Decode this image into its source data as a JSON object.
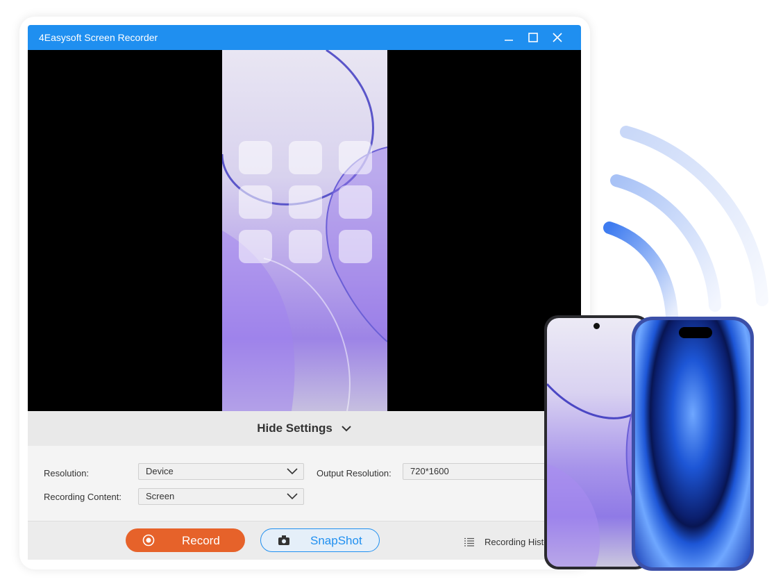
{
  "window": {
    "title": "4Easysoft Screen Recorder",
    "controls": {
      "minimize": "minimize-icon",
      "maximize": "maximize-icon",
      "close": "close-icon"
    }
  },
  "toggle": {
    "label": "Hide Settings"
  },
  "settings": {
    "resolution_label": "Resolution:",
    "resolution_value": "Device",
    "output_resolution_label": "Output Resolution:",
    "output_resolution_value": "720*1600",
    "recording_content_label": "Recording Content:",
    "recording_content_value": "Screen"
  },
  "footer": {
    "record_label": "Record",
    "snapshot_label": "SnapShot",
    "history_label": "Recording Histo"
  },
  "colors": {
    "titlebar": "#1f8ff0",
    "record": "#e6622a",
    "snapshot_border": "#1f8ff0"
  }
}
